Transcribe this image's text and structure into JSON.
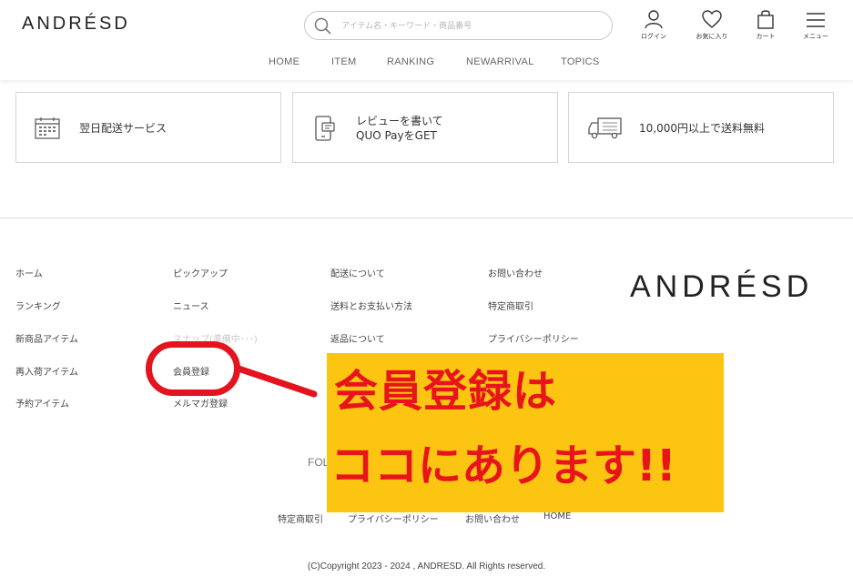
{
  "header": {
    "logo": "ANDRÉSD",
    "search_placeholder": "アイテム名・キーワード・商品番号",
    "icons": {
      "login": "ログイン",
      "favorites": "お気に入り",
      "cart": "カート",
      "menu": "メニュー"
    },
    "nav": [
      "HOME",
      "ITEM",
      "RANKING",
      "NEWARRIVAL",
      "TOPICS"
    ]
  },
  "services": [
    {
      "icon": "calendar-icon",
      "line1": "翌日配送サービス",
      "line2": ""
    },
    {
      "icon": "phone-review-icon",
      "line1": "レビューを書いて",
      "line2": "QUO PayをGET"
    },
    {
      "icon": "truck-icon",
      "line1": "10,000円以上で送料無料",
      "line2": ""
    }
  ],
  "footer": {
    "col1": [
      "ホーム",
      "ランキング",
      "新商品アイテム",
      "再入荷アイテム",
      "予約アイテム"
    ],
    "col2": [
      "ピックアップ",
      "ニュース",
      "スナップ(準備中･･･)",
      "会員登録",
      "メルマガ登録"
    ],
    "col3": [
      "配送について",
      "送料とお支払い方法",
      "返品について"
    ],
    "col4": [
      "お問い合わせ",
      "特定商取引",
      "プライバシーポリシー"
    ],
    "logo": "ANDRÉSD",
    "follow": "FOL",
    "bottom_links": [
      "特定商取引",
      "プライバシーポリシー",
      "お問い合わせ",
      "HOME"
    ],
    "copyright": "(C)Copyright 2023 - 2024 , ANDRESD. All Rights reserved."
  },
  "annotation": {
    "line1": "会員登録は",
    "line2": "ココにあります!!",
    "circle_color": "#e3141e",
    "box_color": "#fcc512",
    "text_color": "#e8141c"
  }
}
